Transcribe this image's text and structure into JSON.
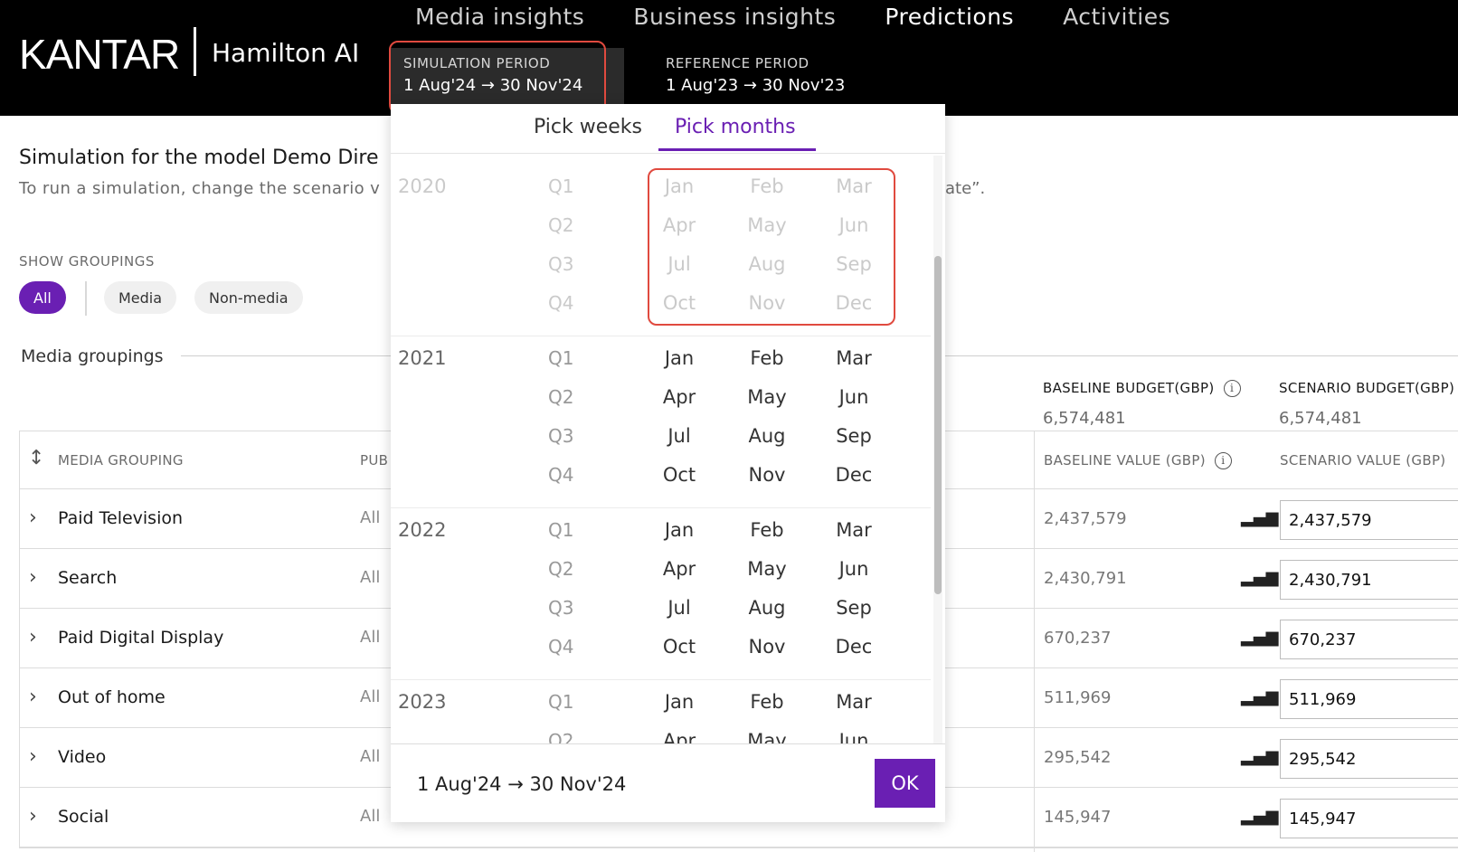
{
  "header": {
    "brand": "KANTAR",
    "product": "Hamilton AI",
    "nav": [
      "Media insights",
      "Business insights",
      "Predictions",
      "Activities"
    ],
    "active_nav": "Predictions",
    "simulation_period": {
      "label": "SIMULATION PERIOD",
      "value": "1 Aug'24 → 30 Nov'24"
    },
    "reference_period": {
      "label": "REFERENCE PERIOD",
      "value": "1 Aug'23 → 30 Nov'23"
    }
  },
  "page": {
    "title": "Simulation for the model Demo Dire",
    "subtitle": "To run a simulation, change the scenario v",
    "subtitle_tail": "ate”.",
    "groupings_label": "SHOW GROUPINGS",
    "chips": [
      "All",
      "Media",
      "Non-media"
    ],
    "section_title": "Media groupings",
    "baseline_budget_label": "BASELINE BUDGET(GBP)",
    "baseline_budget_value": "6,574,481",
    "scenario_budget_label": "SCENARIO BUDGET(GBP)",
    "scenario_budget_value": "6,574,481"
  },
  "table": {
    "columns": {
      "media_grouping": "MEDIA GROUPING",
      "publisher": "PUB",
      "baseline_value": "BASELINE VALUE (GBP)",
      "scenario_value": "SCENARIO VALUE (GBP)"
    },
    "rows": [
      {
        "name": "Paid Television",
        "pub": "All",
        "baseline": "2,437,579",
        "scenario": "2,437,579"
      },
      {
        "name": "Search",
        "pub": "All",
        "baseline": "2,430,791",
        "scenario": "2,430,791"
      },
      {
        "name": "Paid Digital Display",
        "pub": "All",
        "baseline": "670,237",
        "scenario": "670,237"
      },
      {
        "name": "Out of home",
        "pub": "All",
        "baseline": "511,969",
        "scenario": "511,969"
      },
      {
        "name": "Video",
        "pub": "All",
        "baseline": "295,542",
        "scenario": "295,542"
      },
      {
        "name": "Social",
        "pub": "All",
        "baseline": "145,947",
        "scenario": "145,947"
      }
    ]
  },
  "picker": {
    "tabs": [
      "Pick weeks",
      "Pick months"
    ],
    "active_tab": "Pick months",
    "quarters": [
      "Q1",
      "Q2",
      "Q3",
      "Q4"
    ],
    "months": [
      [
        "Jan",
        "Feb",
        "Mar"
      ],
      [
        "Apr",
        "May",
        "Jun"
      ],
      [
        "Jul",
        "Aug",
        "Sep"
      ],
      [
        "Oct",
        "Nov",
        "Dec"
      ]
    ],
    "years": [
      {
        "year": "2020",
        "disabled": true
      },
      {
        "year": "2021",
        "disabled": false
      },
      {
        "year": "2022",
        "disabled": false
      },
      {
        "year": "2023",
        "disabled": false
      }
    ],
    "selected_range": "1 Aug'24 → 30 Nov'24",
    "ok_label": "OK"
  },
  "colors": {
    "accent": "#6a1fb3",
    "highlight": "#e04a3f",
    "topbar": "#000000"
  }
}
